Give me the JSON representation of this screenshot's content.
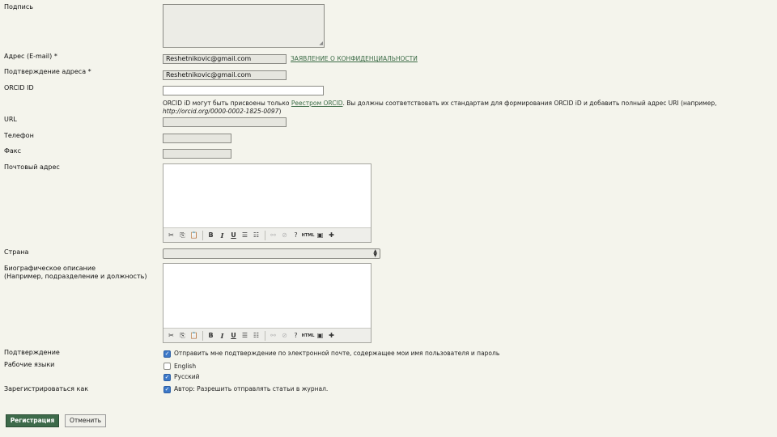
{
  "form": {
    "signature": {
      "label": "Подпись"
    },
    "email": {
      "label": "Адрес (E-mail) *",
      "value": "Reshetnikovic@gmail.com",
      "privacy_link": "ЗАЯВЛЕНИЕ О КОНФИДЕНЦИАЛЬНОСТИ"
    },
    "email_confirm": {
      "label": "Подтверждение адреса *",
      "value": "Reshetnikovic@gmail.com"
    },
    "orcid": {
      "label": "ORCID ID",
      "value": "",
      "help_prefix": "ORCID iD могут быть присвоены только",
      "help_link": "Реестром ORCID",
      "help_suffix": ". Вы должны соответствовать их стандартам для формирования ORCID iD и добавить полный адрес URI (например,",
      "help_example": "http://orcid.org/0000-0002-1825-0097",
      "help_close": ")"
    },
    "url": {
      "label": "URL",
      "value": ""
    },
    "phone": {
      "label": "Телефон",
      "value": ""
    },
    "fax": {
      "label": "Факс",
      "value": ""
    },
    "mailing_address": {
      "label": "Почтовый адрес"
    },
    "country": {
      "label": "Страна",
      "selected": ""
    },
    "bio": {
      "label_line1": "Биографическое описание",
      "label_line2": "(Например, подразделение и должность)"
    },
    "confirmation": {
      "label": "Подтверждение",
      "checked": true,
      "text": "Отправить мне подтверждение по электронной почте, содержащее мои имя пользователя и пароль"
    },
    "languages": {
      "label": "Рабочие языки",
      "options": [
        {
          "text": "English",
          "checked": false
        },
        {
          "text": "Русский",
          "checked": true
        }
      ]
    },
    "register_as": {
      "label": "Зарегистрироваться как",
      "checked": true,
      "text": "Автор: Разрешить отправлять статьи в журнал."
    }
  },
  "editor_toolbar": {
    "cut": "✂",
    "copy": "⎘",
    "paste": "📋",
    "bold": "B",
    "italic": "I",
    "underline": "U",
    "bullets": "☰",
    "numbers": "☷",
    "link": "⚯",
    "unlink": "⊘",
    "help": "?",
    "html": "HTML",
    "image": "▣",
    "media": "✚"
  },
  "actions": {
    "submit": "Регистрация",
    "cancel": "Отменить"
  },
  "colors": {
    "background": "#f4f4ec",
    "accent": "#3d6a4a",
    "checkbox": "#3c78c8"
  }
}
